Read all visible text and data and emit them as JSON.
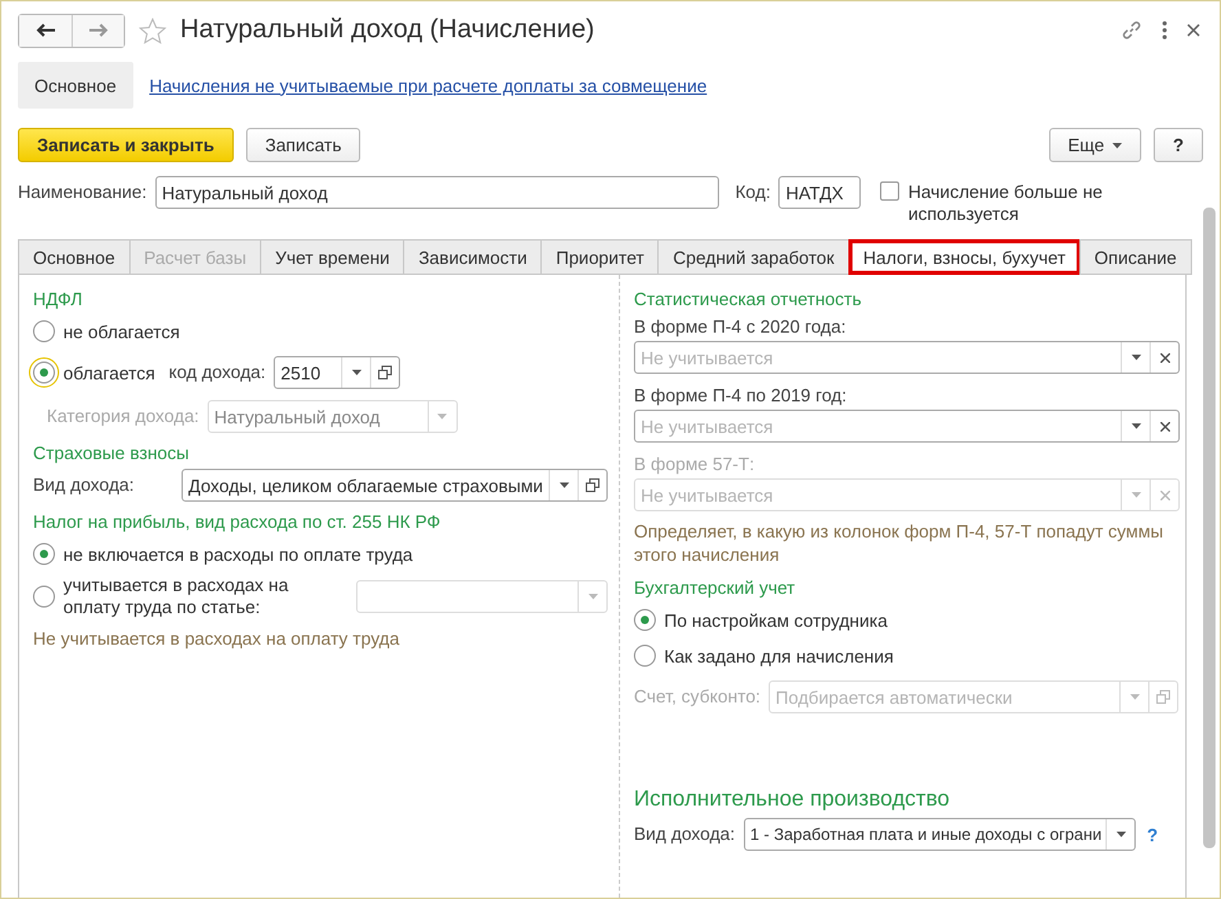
{
  "window": {
    "title": "Натуральный доход (Начисление)"
  },
  "nav": {
    "tabs": [
      {
        "label": "Основное",
        "selected": true
      }
    ],
    "link": "Начисления не учитываемые при расчете доплаты за совмещение"
  },
  "toolbar": {
    "primary": "Записать и закрыть",
    "save": "Записать",
    "more": "Еще",
    "help": "?"
  },
  "header": {
    "name_label": "Наименование:",
    "name_value": "Натуральный доход",
    "code_label": "Код:",
    "code_value": "НАТДХ",
    "unused_label": "Начисление больше не используется",
    "unused_checked": false
  },
  "tabs": [
    {
      "label": "Основное",
      "selected": false,
      "disabled": false,
      "highlighted": false
    },
    {
      "label": "Расчет базы",
      "selected": false,
      "disabled": true,
      "highlighted": false
    },
    {
      "label": "Учет времени",
      "selected": false,
      "disabled": false,
      "highlighted": false
    },
    {
      "label": "Зависимости",
      "selected": false,
      "disabled": false,
      "highlighted": false
    },
    {
      "label": "Приоритет",
      "selected": false,
      "disabled": false,
      "highlighted": false
    },
    {
      "label": "Средний заработок",
      "selected": false,
      "disabled": false,
      "highlighted": false
    },
    {
      "label": "Налоги, взносы, бухучет",
      "selected": true,
      "disabled": false,
      "highlighted": true
    },
    {
      "label": "Описание",
      "selected": false,
      "disabled": false,
      "highlighted": false
    }
  ],
  "ndfl": {
    "title": "НДФЛ",
    "options": [
      {
        "label": "не облагается",
        "selected": false,
        "focused": false
      },
      {
        "label": "облагается",
        "selected": true,
        "focused": true
      }
    ],
    "code_label": "код дохода:",
    "code_value": "2510",
    "category_label": "Категория дохода:",
    "category_value": "Натуральный доход",
    "category_disabled": true
  },
  "insurance": {
    "title": "Страховые взносы",
    "label": "Вид дохода:",
    "value": "Доходы, целиком облагаемые страховыми"
  },
  "profit_tax": {
    "title": "Налог на прибыль, вид расхода по ст. 255 НК РФ",
    "options": [
      {
        "label": "не включается в расходы по оплате труда",
        "selected": true
      },
      {
        "label": "учитывается в расходах на оплату труда по статье:",
        "selected": false
      }
    ],
    "note": "Не учитывается в расходах на оплату труда"
  },
  "statistics": {
    "title": "Статистическая отчетность",
    "fields": [
      {
        "label": "В форме П-4 с 2020 года:",
        "placeholder": "Не учитывается",
        "disabled": false
      },
      {
        "label": "В форме П-4 по 2019 год:",
        "placeholder": "Не учитывается",
        "disabled": false
      },
      {
        "label": "В форме 57-Т:",
        "placeholder": "Не учитывается",
        "disabled": true
      }
    ],
    "note": "Определяет, в какую из колонок форм П-4, 57-Т попадут суммы этого начисления"
  },
  "accounting": {
    "title": "Бухгалтерский учет",
    "options": [
      {
        "label": "По настройкам сотрудника",
        "selected": true
      },
      {
        "label": "Как задано для начисления",
        "selected": false
      }
    ],
    "account_label": "Счет, субконто:",
    "account_placeholder": "Подбирается автоматически",
    "account_disabled": true
  },
  "enforcement": {
    "title": "Исполнительное производство",
    "label": "Вид дохода:",
    "value": "1 - Заработная плата и иные доходы с ограни",
    "help": "?"
  }
}
